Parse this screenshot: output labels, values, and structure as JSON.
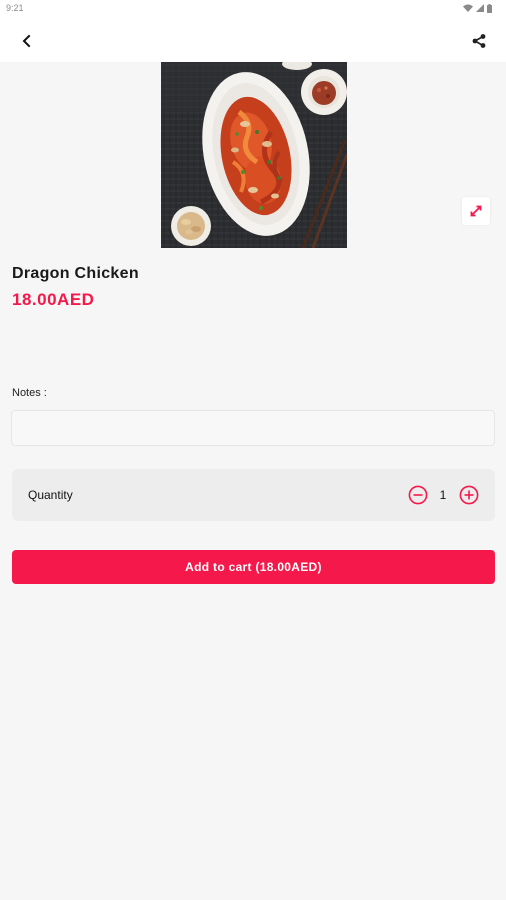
{
  "status_bar": {
    "time": "9:21"
  },
  "product": {
    "name": "Dragon Chicken",
    "price": "18.00AED",
    "image_description_icon": "food-photo"
  },
  "notes": {
    "label": "Notes :",
    "value": "",
    "placeholder": ""
  },
  "quantity": {
    "label": "Quantity",
    "value": "1"
  },
  "cart": {
    "button_label": "Add to cart (18.00AED)"
  },
  "colors": {
    "accent": "#f5184a",
    "background": "#f6f6f6",
    "card": "#ededed",
    "text": "#111111"
  },
  "icons": {
    "back": "back-arrow-icon",
    "share": "share-icon",
    "expand": "expand-icon",
    "minus": "minus-circle-icon",
    "plus": "plus-circle-icon"
  }
}
